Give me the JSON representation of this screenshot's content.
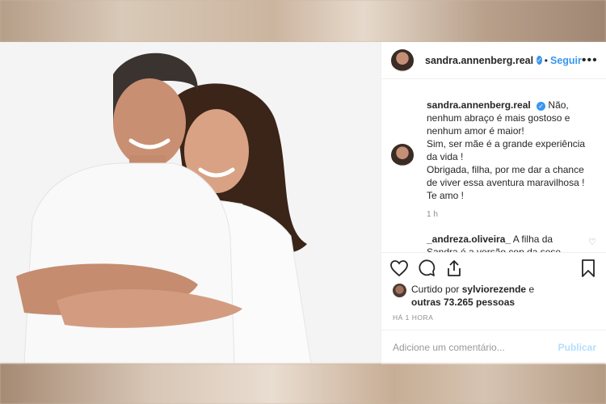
{
  "post": {
    "author": {
      "username": "sandra.annenberg.real",
      "verified_icon": "verified-badge-icon",
      "follow_label": "Seguir",
      "dot": "•",
      "more_label": "•••"
    },
    "caption": {
      "username": "sandra.annenberg.real",
      "lines": [
        "Não, nenhum abraço é mais gostoso e nenhum amor é maior!",
        "Sim, ser mãe é a grande experiência da vida !",
        "Obrigada, filha, por me dar a chance de viver essa aventura maravilhosa !",
        "Te amo !"
      ],
      "time": "1 h"
    },
    "comment": {
      "username": "_andreza.oliveira_",
      "text": "A filha da Sandra é a versão cop da sese"
    },
    "likes": {
      "prefix": "Curtido por",
      "user": "sylviorezende",
      "connector": "e",
      "others": "outras 73.265 pessoas"
    },
    "posted_ago": "HÁ 1 HORA",
    "comment_placeholder": "Adicione um comentário...",
    "publish_label": "Publicar"
  },
  "colors": {
    "accent": "#3897f0",
    "publish_disabled": "#b2dffc",
    "text": "#262626",
    "muted": "#8e8e8e"
  }
}
